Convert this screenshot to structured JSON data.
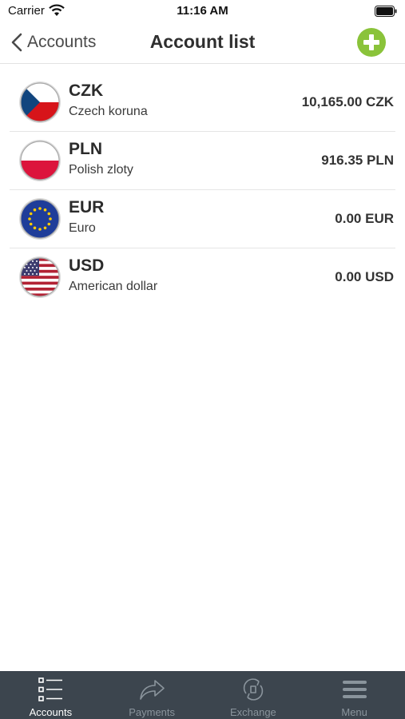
{
  "status_bar": {
    "carrier": "Carrier",
    "time": "11:16 AM"
  },
  "nav": {
    "back_label": "Accounts",
    "title": "Account list",
    "add_icon": "add-circle-icon"
  },
  "accounts": [
    {
      "code": "CZK",
      "name": "Czech koruna",
      "balance": "10,165.00 CZK",
      "flag": "czech-flag-icon"
    },
    {
      "code": "PLN",
      "name": "Polish zloty",
      "balance": "916.35 PLN",
      "flag": "polish-flag-icon"
    },
    {
      "code": "EUR",
      "name": "Euro",
      "balance": "0.00 EUR",
      "flag": "eu-flag-icon"
    },
    {
      "code": "USD",
      "name": "American dollar",
      "balance": "0.00 USD",
      "flag": "us-flag-icon"
    }
  ],
  "tabs": [
    {
      "label": "Accounts",
      "icon": "list-icon",
      "active": true
    },
    {
      "label": "Payments",
      "icon": "share-arrow-icon",
      "active": false
    },
    {
      "label": "Exchange",
      "icon": "exchange-icon",
      "active": false
    },
    {
      "label": "Menu",
      "icon": "hamburger-menu-icon",
      "active": false
    }
  ],
  "colors": {
    "accent_green": "#8ac33a",
    "tab_bar_bg": "#3c454e",
    "tab_active": "#ffffff",
    "tab_inactive": "#8a949c"
  }
}
